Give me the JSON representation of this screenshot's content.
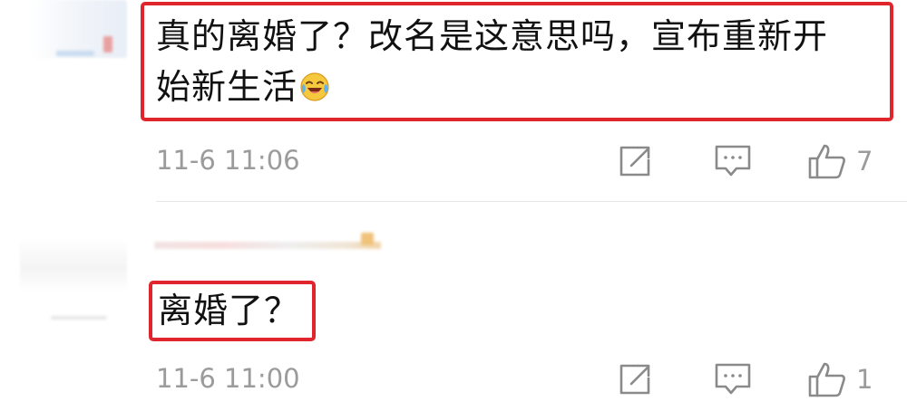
{
  "comments": [
    {
      "text_line1": "真的离婚了？改名是这意思吗，宣布重新开",
      "text_line2": "始新生活",
      "emoji": "laugh-cry-emoji",
      "timestamp": "11-6 11:06",
      "likes": "7"
    },
    {
      "text_line1": "离婚了？",
      "timestamp": "11-6 11:00",
      "likes": "1"
    }
  ],
  "colors": {
    "highlight": "#e0262c",
    "meta_gray": "#9b9b9b",
    "icon_gray": "#8a8a8a"
  },
  "icons": {
    "share": "share-icon",
    "reply": "comment-icon",
    "like": "thumbs-up-icon"
  }
}
